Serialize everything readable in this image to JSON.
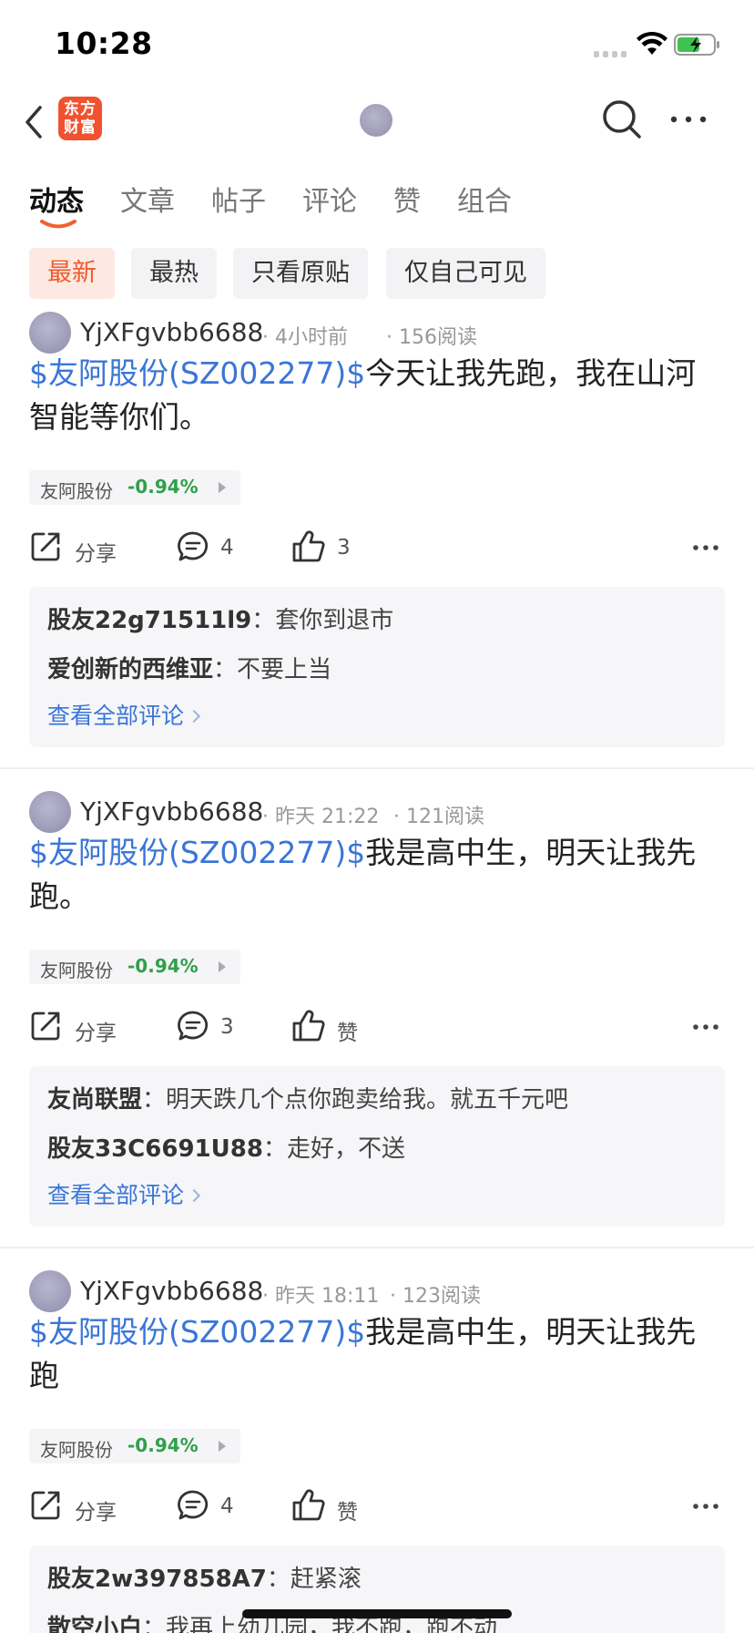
{
  "status_bar": {
    "time": "10:28"
  },
  "nav": {
    "logo_line1": "东方",
    "logo_line2": "财富"
  },
  "tabs": [
    {
      "label": "动态",
      "active": true
    },
    {
      "label": "文章"
    },
    {
      "label": "帖子"
    },
    {
      "label": "评论"
    },
    {
      "label": "赞"
    },
    {
      "label": "组合"
    }
  ],
  "filters": [
    {
      "label": "最新",
      "active": true
    },
    {
      "label": "最热"
    },
    {
      "label": "只看原贴"
    },
    {
      "label": "仅自己可见"
    }
  ],
  "posts": [
    {
      "username": "YjXFgvbb6688",
      "time": "4小时前",
      "reads": "156阅读",
      "stock_link": "$友阿股份(SZ002277)$",
      "text": "今天让我先跑，我在山河智能等你们。",
      "stock_tag": {
        "name": "友阿股份",
        "change": "-0.94%"
      },
      "share_label": "分享",
      "comment_count": "4",
      "like_label": "3",
      "comments": [
        {
          "author": "股友22g71511l9",
          "text": "套你到退市"
        },
        {
          "author": "爱创新的西维亚",
          "text": "不要上当"
        }
      ],
      "view_all": "查看全部评论"
    },
    {
      "username": "YjXFgvbb6688",
      "time": "昨天 21:22",
      "reads": "121阅读",
      "stock_link": "$友阿股份(SZ002277)$",
      "text": "我是高中生，明天让我先跑。",
      "stock_tag": {
        "name": "友阿股份",
        "change": "-0.94%"
      },
      "share_label": "分享",
      "comment_count": "3",
      "like_label": "赞",
      "comments": [
        {
          "author": "友尚联盟",
          "text": "明天跌几个点你跑卖给我。就五千元吧"
        },
        {
          "author": "股友33C6691U88",
          "text": "走好，不送"
        }
      ],
      "view_all": "查看全部评论"
    },
    {
      "username": "YjXFgvbb6688",
      "time": "昨天 18:11",
      "reads": "123阅读",
      "stock_link": "$友阿股份(SZ002277)$",
      "text": "我是高中生，明天让我先跑",
      "stock_tag": {
        "name": "友阿股份",
        "change": "-0.94%"
      },
      "share_label": "分享",
      "comment_count": "4",
      "like_label": "赞",
      "comments": [
        {
          "author": "股友2w397858A7",
          "text": "赶紧滚"
        },
        {
          "author": "散空小白",
          "text": "我再上幼儿园，我不跑，跑不动"
        }
      ]
    }
  ]
}
